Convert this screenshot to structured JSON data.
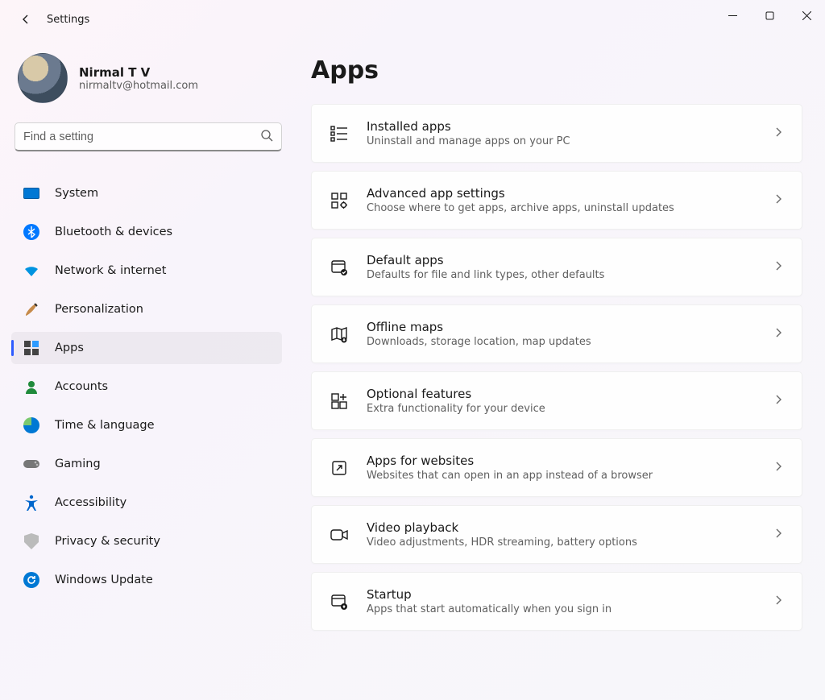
{
  "header": {
    "title": "Settings"
  },
  "user": {
    "name": "Nirmal T V",
    "email": "nirmaltv@hotmail.com"
  },
  "search": {
    "placeholder": "Find a setting"
  },
  "sidebar": {
    "items": [
      {
        "id": "system",
        "label": "System"
      },
      {
        "id": "bluetooth",
        "label": "Bluetooth & devices"
      },
      {
        "id": "network",
        "label": "Network & internet"
      },
      {
        "id": "personalization",
        "label": "Personalization"
      },
      {
        "id": "apps",
        "label": "Apps",
        "selected": true
      },
      {
        "id": "accounts",
        "label": "Accounts"
      },
      {
        "id": "time",
        "label": "Time & language"
      },
      {
        "id": "gaming",
        "label": "Gaming"
      },
      {
        "id": "accessibility",
        "label": "Accessibility"
      },
      {
        "id": "privacy",
        "label": "Privacy & security"
      },
      {
        "id": "update",
        "label": "Windows Update"
      }
    ]
  },
  "page": {
    "title": "Apps"
  },
  "items": [
    {
      "id": "installed-apps",
      "title": "Installed apps",
      "desc": "Uninstall and manage apps on your PC"
    },
    {
      "id": "advanced",
      "title": "Advanced app settings",
      "desc": "Choose where to get apps, archive apps, uninstall updates"
    },
    {
      "id": "default-apps",
      "title": "Default apps",
      "desc": "Defaults for file and link types, other defaults"
    },
    {
      "id": "offline-maps",
      "title": "Offline maps",
      "desc": "Downloads, storage location, map updates"
    },
    {
      "id": "optional",
      "title": "Optional features",
      "desc": "Extra functionality for your device"
    },
    {
      "id": "apps-websites",
      "title": "Apps for websites",
      "desc": "Websites that can open in an app instead of a browser"
    },
    {
      "id": "video",
      "title": "Video playback",
      "desc": "Video adjustments, HDR streaming, battery options"
    },
    {
      "id": "startup",
      "title": "Startup",
      "desc": "Apps that start automatically when you sign in"
    }
  ]
}
